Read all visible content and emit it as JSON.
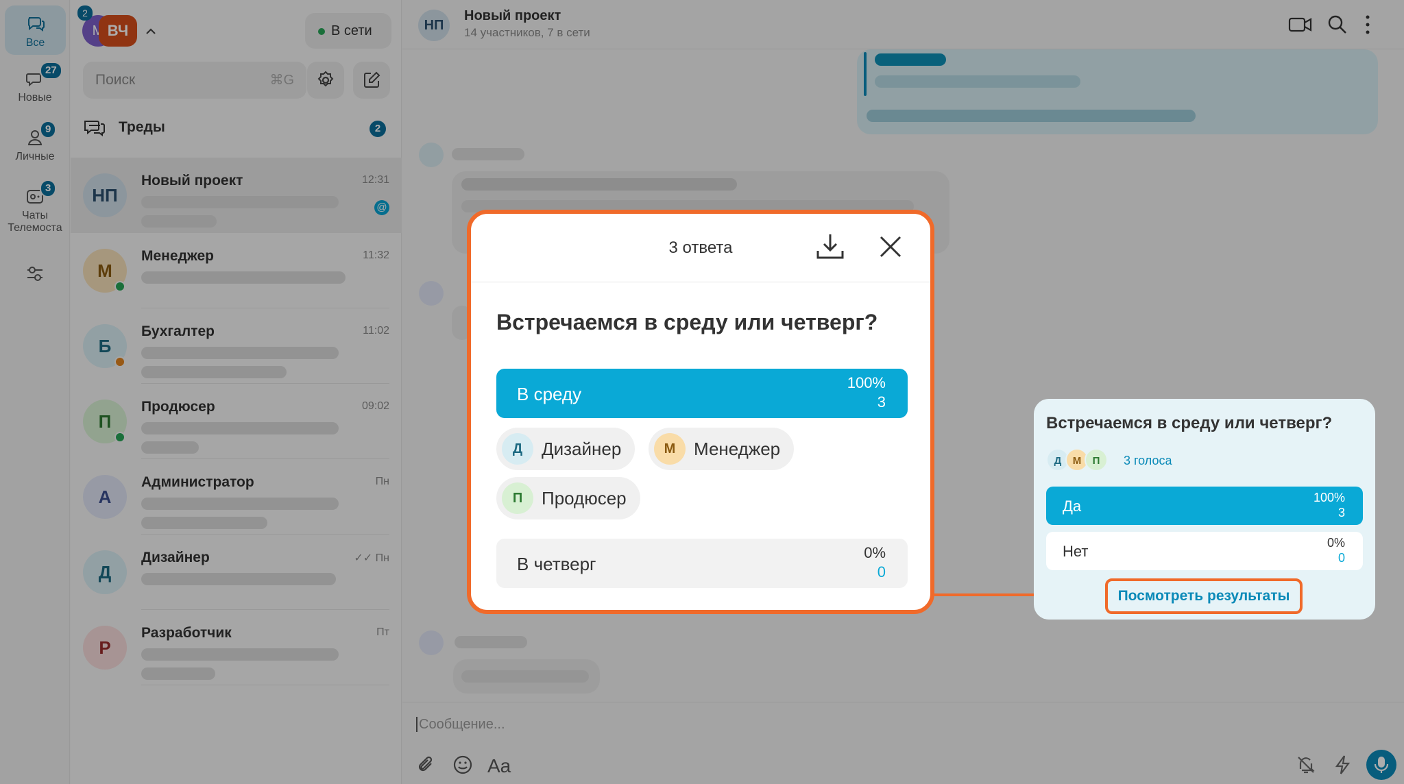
{
  "rail": {
    "items": [
      {
        "label": "Все",
        "icon": "chat-bubbles-icon",
        "badge": ""
      },
      {
        "label": "Новые",
        "icon": "new-chat-icon",
        "badge": "27"
      },
      {
        "label": "Личные",
        "icon": "person-icon",
        "badge": "9"
      },
      {
        "label": "Чаты Телемоста",
        "icon": "telemost-icon",
        "badge": "3"
      }
    ],
    "settings_icon": "sliders-icon"
  },
  "account": {
    "initial": "М",
    "initials": "ВЧ",
    "badge": "2"
  },
  "status": {
    "label": "В сети",
    "color": "#27a456"
  },
  "search": {
    "placeholder": "Поиск",
    "shortcut": "⌘G"
  },
  "threads": {
    "label": "Треды",
    "badge": "2"
  },
  "chats": [
    {
      "initials": "НП",
      "name": "Новый проект",
      "time": "12:31",
      "color": "#cfdde8",
      "fg": "#2b4f6e",
      "status": "",
      "mention": "@"
    },
    {
      "initials": "М",
      "name": "Менеджер",
      "time": "11:32",
      "color": "#f5dfb8",
      "fg": "#8a5a10",
      "status": "#27a456"
    },
    {
      "initials": "Б",
      "name": "Бухгалтер",
      "time": "11:02",
      "color": "#d7ecf2",
      "fg": "#1d6a82",
      "status": "#e0831f"
    },
    {
      "initials": "П",
      "name": "Продюсер",
      "time": "09:02",
      "color": "#d8f0d3",
      "fg": "#2d7a32",
      "status": "#27a456"
    },
    {
      "initials": "А",
      "name": "Администратор",
      "time": "Пн",
      "color": "#dfe4f4",
      "fg": "#3b4f8f",
      "status": ""
    },
    {
      "initials": "Д",
      "name": "Дизайнер",
      "time": "Пн",
      "color": "#d7ecf2",
      "fg": "#1d6a82",
      "status": "",
      "read": "✓✓"
    },
    {
      "initials": "Р",
      "name": "Разработчик",
      "time": "Пт",
      "color": "#f6dada",
      "fg": "#9a2b2b",
      "status": ""
    }
  ],
  "conversation": {
    "initials": "НП",
    "title": "Новый проект",
    "subtitle": "14 участников, 7 в сети",
    "compose_placeholder": "Сообщение...",
    "text_format_label": "Aa"
  },
  "poll_modal": {
    "title": "3 ответа",
    "question": "Встречаемся в среду или четверг?",
    "options": [
      {
        "label": "В среду",
        "percent": "100%",
        "count": "3",
        "fraction": 1.0
      },
      {
        "label": "В четверг",
        "percent": "0%",
        "count": "0",
        "fraction": 0.0
      }
    ],
    "voters": [
      {
        "initial": "Д",
        "name": "Дизайнер",
        "color": "#d7ecf2",
        "fg": "#1d6a82"
      },
      {
        "initial": "М",
        "name": "Менеджер",
        "color": "#f9dca8",
        "fg": "#8a5a10"
      },
      {
        "initial": "П",
        "name": "Продюсер",
        "color": "#d8f0d3",
        "fg": "#2d7a32"
      }
    ]
  },
  "poll_card": {
    "question": "Встречаемся в среду или четверг?",
    "voter_initials": [
      "Д",
      "М",
      "П"
    ],
    "votes_label": "3 голоса",
    "options": [
      {
        "label": "Да",
        "percent": "100%",
        "count": "3",
        "fraction": 1.0
      },
      {
        "label": "Нет",
        "percent": "0%",
        "count": "0",
        "fraction": 0.0
      }
    ],
    "results_button": "Посмотреть результаты"
  },
  "colors": {
    "accent": "#0aa9d6",
    "highlight": "#f06a2a",
    "badge": "#0b6e9a"
  }
}
